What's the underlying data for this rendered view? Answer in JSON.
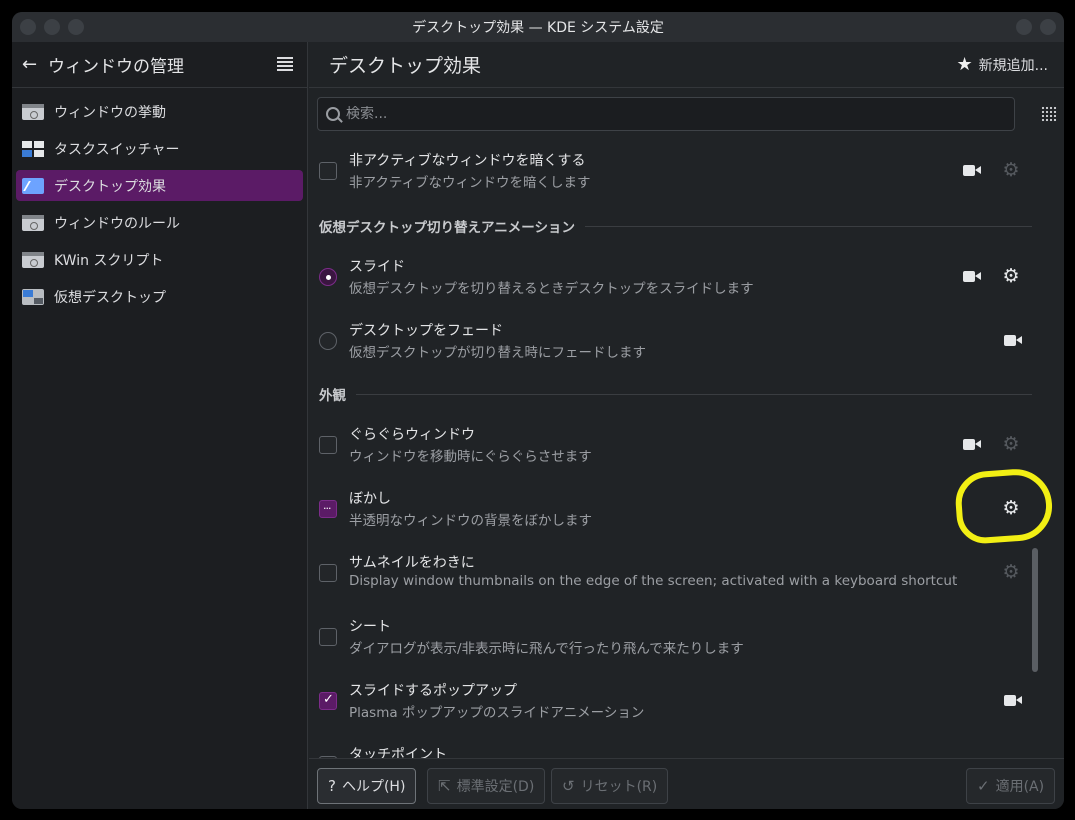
{
  "window": {
    "title": "デスクトップ効果 — KDE システム設定"
  },
  "sidebar": {
    "title": "ウィンドウの管理",
    "items": [
      {
        "label": "ウィンドウの挙動",
        "icon": "window-behavior-icon"
      },
      {
        "label": "タスクスイッチャー",
        "icon": "task-switcher-icon"
      },
      {
        "label": "デスクトップ効果",
        "icon": "desktop-effects-icon",
        "active": true
      },
      {
        "label": "ウィンドウのルール",
        "icon": "window-rules-icon"
      },
      {
        "label": "KWin スクリプト",
        "icon": "kwin-scripts-icon"
      },
      {
        "label": "仮想デスクトップ",
        "icon": "virtual-desktops-icon"
      }
    ]
  },
  "main": {
    "title": "デスクトップ効果",
    "new_button": "新規追加...",
    "search_placeholder": "検索...",
    "effects": {
      "dim_inactive": {
        "title": "非アクティブなウィンドウを暗くする",
        "desc": "非アクティブなウィンドウを暗くします"
      },
      "section_virtual": "仮想デスクトップ切り替えアニメーション",
      "slide": {
        "title": "スライド",
        "desc": "仮想デスクトップを切り替えるときデスクトップをスライドします"
      },
      "fade_desktop": {
        "title": "デスクトップをフェード",
        "desc": "仮想デスクトップが切り替え時にフェードします"
      },
      "section_appearance": "外観",
      "wobbly": {
        "title": "ぐらぐらウィンドウ",
        "desc": "ウィンドウを移動時にぐらぐらさせます"
      },
      "blur": {
        "title": "ぼかし",
        "desc": "半透明なウィンドウの背景をぼかします"
      },
      "thumbnail_aside": {
        "title": "サムネイルをわきに",
        "desc": "Display window thumbnails on the edge of the screen; activated with a keyboard shortcut"
      },
      "sheet": {
        "title": "シート",
        "desc": "ダイアログが表示/非表示時に飛んで行ったり飛んで来たりします"
      },
      "sliding_popups": {
        "title": "スライドするポップアップ",
        "desc": "Plasma ポップアップのスライドアニメーション"
      },
      "touch_points": {
        "title": "タッチポイント"
      }
    }
  },
  "footer": {
    "help": "ヘルプ(H)",
    "defaults": "標準設定(D)",
    "reset": "リセット(R)",
    "apply": "適用(A)"
  },
  "colors": {
    "accent": "#5b1b66",
    "highlight": "#f2ef14"
  }
}
